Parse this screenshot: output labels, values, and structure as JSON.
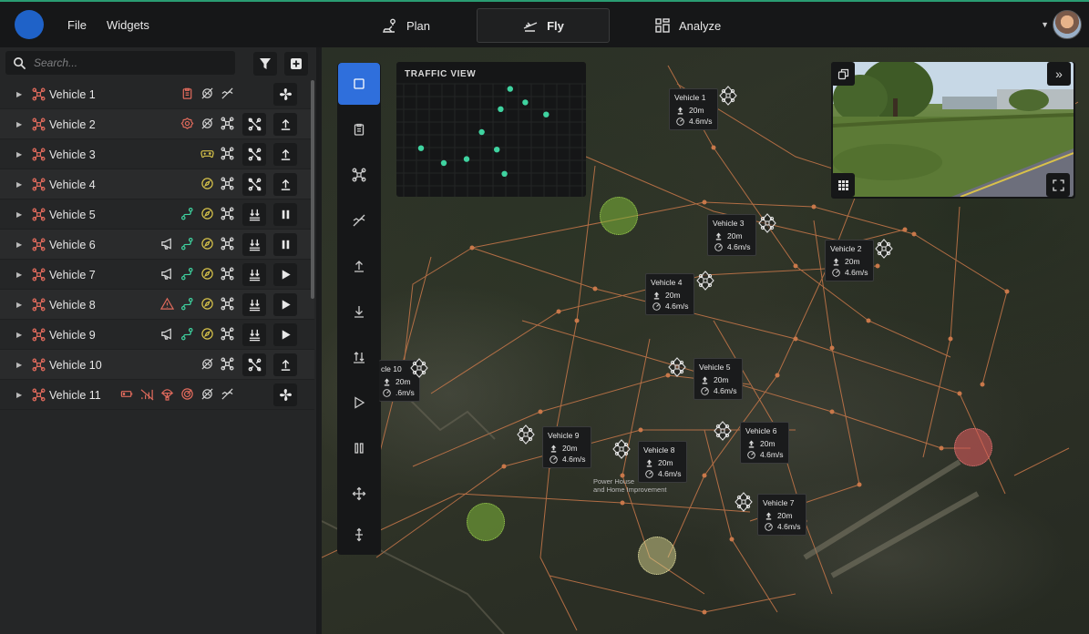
{
  "app": {
    "menu": [
      "File",
      "Widgets"
    ],
    "tabs": [
      {
        "label": "Plan",
        "icon": "plan-icon",
        "active": false
      },
      {
        "label": "Fly",
        "icon": "fly-icon",
        "active": true
      },
      {
        "label": "Analyze",
        "icon": "analyze-icon",
        "active": false
      }
    ]
  },
  "sidebar": {
    "search_placeholder": "Search...",
    "vehicles": [
      {
        "name": "Vehicle 1",
        "statuses": [
          "clipboard",
          "no-view",
          "no-link"
        ],
        "action1": "",
        "action2": "fan"
      },
      {
        "name": "Vehicle 2",
        "statuses": [
          "gear",
          "no-view",
          "drone"
        ],
        "action1": "no-drone",
        "action2": "upload"
      },
      {
        "name": "Vehicle 3",
        "statuses": [
          "controller",
          "drone"
        ],
        "action1": "no-drone",
        "action2": "upload"
      },
      {
        "name": "Vehicle 4",
        "statuses": [
          "compass",
          "drone"
        ],
        "action1": "no-drone",
        "action2": "upload"
      },
      {
        "name": "Vehicle 5",
        "statuses": [
          "route",
          "compass",
          "drone"
        ],
        "action1": "land",
        "action2": "pause"
      },
      {
        "name": "Vehicle 6",
        "statuses": [
          "megaphone",
          "route",
          "compass",
          "drone"
        ],
        "action1": "land",
        "action2": "pause"
      },
      {
        "name": "Vehicle 7",
        "statuses": [
          "megaphone",
          "route",
          "compass",
          "drone"
        ],
        "action1": "land",
        "action2": "play"
      },
      {
        "name": "Vehicle 8",
        "statuses": [
          "warning",
          "route",
          "compass",
          "drone"
        ],
        "action1": "land",
        "action2": "play"
      },
      {
        "name": "Vehicle 9",
        "statuses": [
          "megaphone",
          "route",
          "compass",
          "drone"
        ],
        "action1": "land",
        "action2": "play"
      },
      {
        "name": "Vehicle 10",
        "statuses": [
          "no-view",
          "drone"
        ],
        "action1": "no-drone",
        "action2": "upload"
      },
      {
        "name": "Vehicle 11",
        "statuses": [
          "battery",
          "no-signal",
          "parachute",
          "target",
          "no-view",
          "no-link"
        ],
        "action1": "",
        "action2": "fan"
      }
    ]
  },
  "map": {
    "traffic_title": "TRAFFIC VIEW",
    "traffic_points": [
      [
        0.6,
        0.2
      ],
      [
        0.68,
        0.3
      ],
      [
        0.55,
        0.35
      ],
      [
        0.79,
        0.39
      ],
      [
        0.45,
        0.52
      ],
      [
        0.13,
        0.64
      ],
      [
        0.53,
        0.65
      ],
      [
        0.37,
        0.72
      ],
      [
        0.25,
        0.75
      ],
      [
        0.57,
        0.83
      ]
    ],
    "place_label": [
      "Power House",
      "and Home Improvement"
    ],
    "callouts": [
      {
        "title": "Vehicle 1",
        "alt": "20m",
        "speed": "4.6m/s"
      },
      {
        "title": "Vehicle 2",
        "alt": "20m",
        "speed": "4.6m/s"
      },
      {
        "title": "Vehicle 3",
        "alt": "20m",
        "speed": "4.6m/s"
      },
      {
        "title": "Vehicle 4",
        "alt": "20m",
        "speed": "4.6m/s"
      },
      {
        "title": "Vehicle 5",
        "alt": "20m",
        "speed": "4.6m/s"
      },
      {
        "title": "Vehicle 6",
        "alt": "20m",
        "speed": "4.6m/s"
      },
      {
        "title": "Vehicle 7",
        "alt": "20m",
        "speed": "4.6m/s"
      },
      {
        "title": "Vehicle 8",
        "alt": "20m",
        "speed": "4.6m/s"
      },
      {
        "title": "Vehicle 9",
        "alt": "20m",
        "speed": "4.6m/s"
      },
      {
        "title": "cle 10",
        "alt": "20m",
        "speed": ".6m/s"
      }
    ]
  },
  "colors": {
    "accent": "#2f6fdc",
    "route": "#c9784a",
    "drone_red": "#e06a5c",
    "status_green": "#3fd3a0",
    "status_yellow": "#d6c24a",
    "zone_green": "#7fb83a",
    "zone_yellow": "#d9d690",
    "zone_red": "#d65a5a"
  }
}
